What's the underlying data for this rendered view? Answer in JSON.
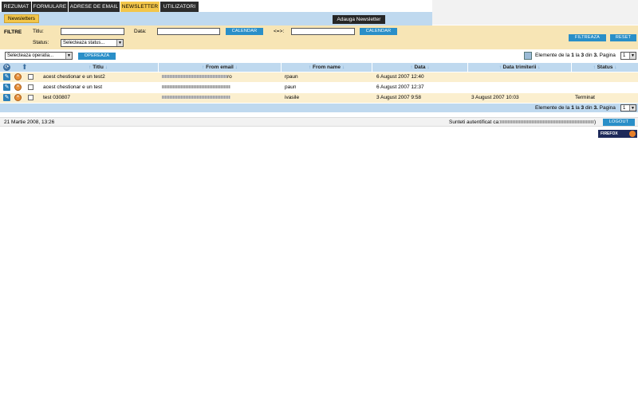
{
  "nav": {
    "tabs": [
      {
        "label": "REZUMAT",
        "active": false
      },
      {
        "label": "FORMULARE",
        "active": false
      },
      {
        "label": "ADRESE DE EMAIL",
        "active": false
      },
      {
        "label": "NEWSLETTER",
        "active": true
      },
      {
        "label": "UTILIZATORI",
        "active": false
      }
    ],
    "subtab": "Newsletters",
    "add_button": "Adauga Newsletter"
  },
  "filters": {
    "title": "FILTRE",
    "titlu_label": "Titlu:",
    "data_label": "Data:",
    "range_label": "<=>:",
    "status_label": "Status:",
    "status_value": "Selecteaza status...",
    "calendar_label": "CALENDAR",
    "filter_button": "FILTREAZA",
    "reset_button": "RESET"
  },
  "ops": {
    "select_value": "Selecteaza operatia...",
    "button": "OPEREAZA"
  },
  "pagination": {
    "prefix": "Elemente de la",
    "from": "1",
    "mid1": "la",
    "to": "3",
    "mid2": "din",
    "total": "3.",
    "page_label": "Pagina",
    "page": "1"
  },
  "table": {
    "columns": [
      "Titlu",
      "From email",
      "From name",
      "Data",
      "Data trimiterii",
      "Status"
    ],
    "rows": [
      {
        "titlu": "acest chestionar e un test2",
        "from_email_end": "ro",
        "from_name": "rpaun",
        "data": "6 August 2007 12:40",
        "data_trimiterii": "",
        "status": ""
      },
      {
        "titlu": "acest chestionar e un test",
        "from_email_end": "",
        "from_name": "paun",
        "data": "6 August 2007 12:37",
        "data_trimiterii": "",
        "status": ""
      },
      {
        "titlu": "test 030807",
        "from_email_end": "",
        "from_name": "ivasile",
        "data": "3 August 2007 9:58",
        "data_trimiterii": "3 August 2007 10:03",
        "status": "Terminat"
      }
    ]
  },
  "footer": {
    "date": "21 Martie 2008, 13:26",
    "auth_text": "Sunteti autentificat ca:",
    "auth_close": ")",
    "logout": "LOGOUT",
    "badge": "FIREFOX"
  },
  "colors": {
    "accent": "#f3c64a",
    "header_blue": "#bfd9ef",
    "filter_bg": "#f7e5b5",
    "button_blue": "#2a8fc8",
    "row_alt": "#fbefcf"
  },
  "icons": [
    "edit-icon",
    "delete-icon",
    "refresh-icon",
    "up-arrow-icon",
    "sort-arrow-icon",
    "list-view-icon",
    "firefox-icon"
  ]
}
